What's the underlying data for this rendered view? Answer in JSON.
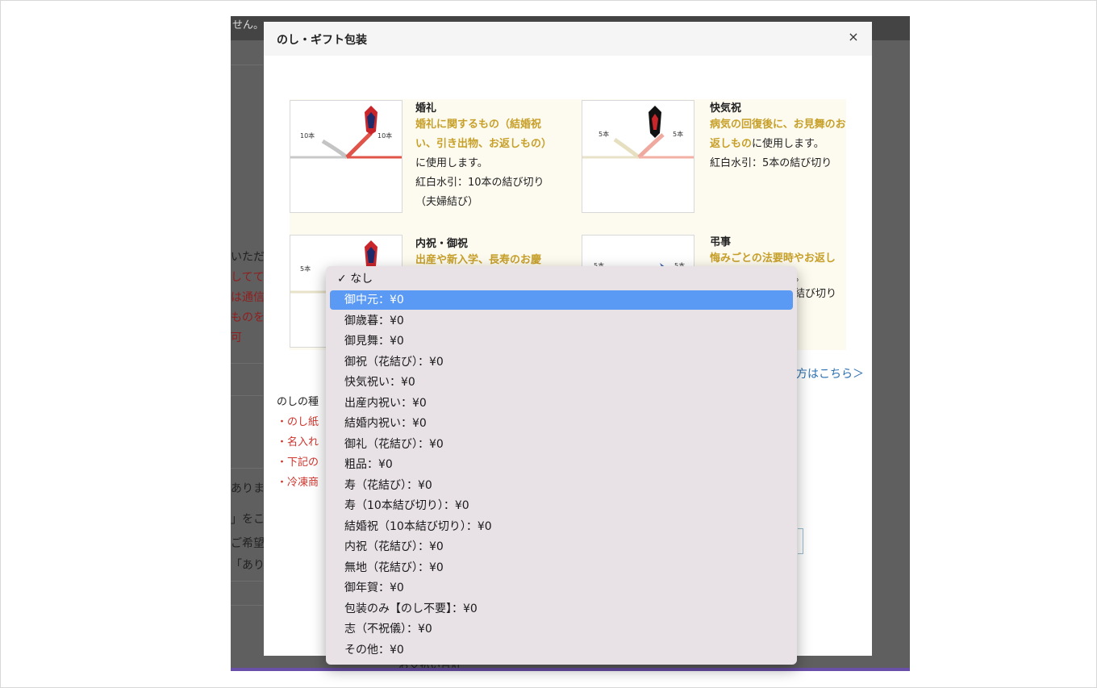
{
  "background": {
    "top_text": "せん。",
    "snippets": [
      "いただ",
      "しててあ",
      "は通信",
      "ものを",
      "可",
      "ありま",
      "」をこ",
      "ご希望",
      "「ありま"
    ],
    "bottom_text": "お支払い合計"
  },
  "modal": {
    "title": "のし・ギフト包装",
    "close_label": "×",
    "cards": [
      {
        "title": "婚礼",
        "gold_text": "婚礼に関するもの（結婚祝い、引き出物、お返しもの）",
        "text": "に使用します。",
        "note": "紅白水引：10本の結び切り（夫婦結び）",
        "count_label": "10本",
        "icon": "noshi-mizuhiki-icon"
      },
      {
        "title": "快気祝",
        "gold_text": "病気の回復後に、お見舞のお返しもの",
        "text": "に使用します。",
        "note": "紅白水引：5本の結び切り",
        "count_label": "5本",
        "icon": "noshi-mizuhiki-icon"
      },
      {
        "title": "内祝・御祝",
        "gold_text": "出産や新入学、長寿のお慶",
        "count_label": "5本",
        "icon": "noshi-mizuhiki-icon"
      },
      {
        "title": "弔事",
        "gold_text": "悔みごとの法要時やお返し",
        "tail_a": "。",
        "tail_b": "結び切り",
        "count_label": "5本",
        "icon": "mourning-mizuhiki-icon"
      }
    ],
    "link_text": "方はこちら＞",
    "noshi_types_label": "のしの種",
    "bullets": [
      "・のし紙",
      "・名入れ",
      "・下記の",
      "・冷凍商"
    ]
  },
  "dropdown": {
    "selected": "なし",
    "active": "御中元：¥0",
    "options": [
      "なし",
      "御中元：¥0",
      "御歳暮：¥0",
      "御見舞：¥0",
      "御祝（花結び）：¥0",
      "快気祝い：¥0",
      "出産内祝い：¥0",
      "結婚内祝い：¥0",
      "御礼（花結び）：¥0",
      "粗品：¥0",
      "寿（花結び）：¥0",
      "寿（10本結び切り）：¥0",
      "結婚祝（10本結び切り）：¥0",
      "内祝（花結び）：¥0",
      "無地（花結び）：¥0",
      "御年賀：¥0",
      "包装のみ【のし不要】：¥0",
      "志（不祝儀）：¥0",
      "その他：¥0"
    ],
    "check_mark": "✓"
  },
  "colors": {
    "accent_gold": "#c7a02a",
    "link_blue": "#2a6fb0",
    "warning_red": "#d0332b",
    "highlight_blue": "#5a9af5",
    "overlay": "#5f5f5f"
  }
}
